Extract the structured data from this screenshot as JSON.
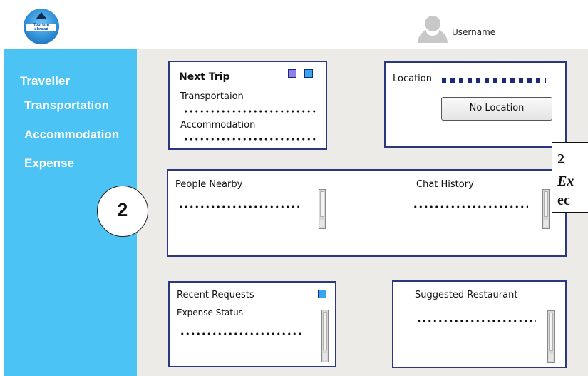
{
  "header": {
    "logo_text": "Tourism abroad",
    "username": "Username"
  },
  "sidebar": {
    "items": [
      {
        "label": "Traveller"
      },
      {
        "label": "Transportation"
      },
      {
        "label": "Accommodation"
      },
      {
        "label": "Expense"
      }
    ]
  },
  "next_trip": {
    "title": "Next Trip",
    "transport_label": "Transportaion",
    "accommodation_label": "Accommodation"
  },
  "location": {
    "label": "Location",
    "button_label": "No Location"
  },
  "people_nearby": {
    "label": "People Nearby"
  },
  "chat_history": {
    "label": "Chat History"
  },
  "recent_requests": {
    "title": "Recent Requests",
    "status_label": "Expense Status"
  },
  "suggested_restaurant": {
    "title": "Suggested Restaurant"
  },
  "annotation": {
    "marker": "2",
    "note_lines": [
      "2",
      "Ex",
      "ec"
    ]
  },
  "colors": {
    "sidebar_bg": "#4cc3f5",
    "card_border": "#2b3880",
    "main_bg": "#edebe7",
    "icon_square_purple": "#8f7fe6",
    "icon_square_blue": "#35a7ef"
  }
}
